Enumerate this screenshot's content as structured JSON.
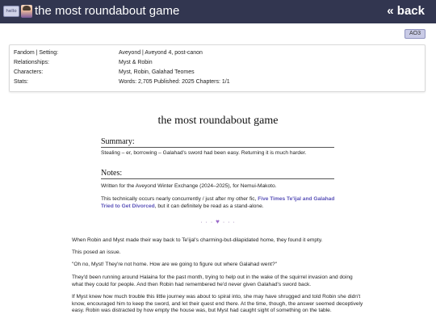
{
  "header": {
    "logo_text": "hello",
    "site_title": "the most roundabout game",
    "back_label": "« back"
  },
  "ao3_label": "AO3",
  "meta": {
    "rows": [
      {
        "key": "Fandom | Setting:",
        "value": "Aveyond | Aveyond 4, post-canon"
      },
      {
        "key": "Relationships:",
        "value": "Myst & Robin"
      },
      {
        "key": "Characters:",
        "value": "Myst, Robin, Galahad Teomes"
      },
      {
        "key": "Stats:",
        "value": "Words: 2,705   Published: 2025   Chapters: 1/1"
      }
    ]
  },
  "work_title": "the most roundabout game",
  "summary": {
    "heading": "Summary:",
    "text": "Stealing – er, borrowing – Galahad's sword had been easy. Returning it is much harder."
  },
  "notes": {
    "heading": "Notes:",
    "line1": "Written for the Aveyond Winter Exchange (2024–2025), for Nemui-Makoto.",
    "line2_pre": "This technically occurs nearly concurrently / just after my other fic, ",
    "line2_link": "Five Times Te'ijal and Galahad Tried to Get Divorced",
    "line2_post": ", but it can definitely be read as a stand-alone."
  },
  "divider": {
    "left": "· · ·",
    "heart": "♥",
    "right": "· · ·"
  },
  "story": [
    "When Robin and Myst made their way back to Te'ijal's charming-but-dilapidated home, they found it empty.",
    "This posed an issue.",
    "\"Oh no, Myst! They're not home. How are we going to figure out where Galahad went?\"",
    "They'd been running around Halaina for the past month, trying to help out in the wake of the squirrel invasion and doing what they could for people. And then Robin had remembered he'd never given Galahad's sword back.",
    "If Myst knew how much trouble this little journey was about to spiral into, she may have shrugged and told Robin she didn't know, encouraged him to keep the sword, and let their quest end there. At the time, though, the answer seemed deceptively easy. Robin was distracted by how empty the house was, but Myst had caught sight of something on the table."
  ],
  "colors": {
    "header_bg": "#323650",
    "link": "#5a52b8",
    "accent": "#9b6bc9"
  }
}
